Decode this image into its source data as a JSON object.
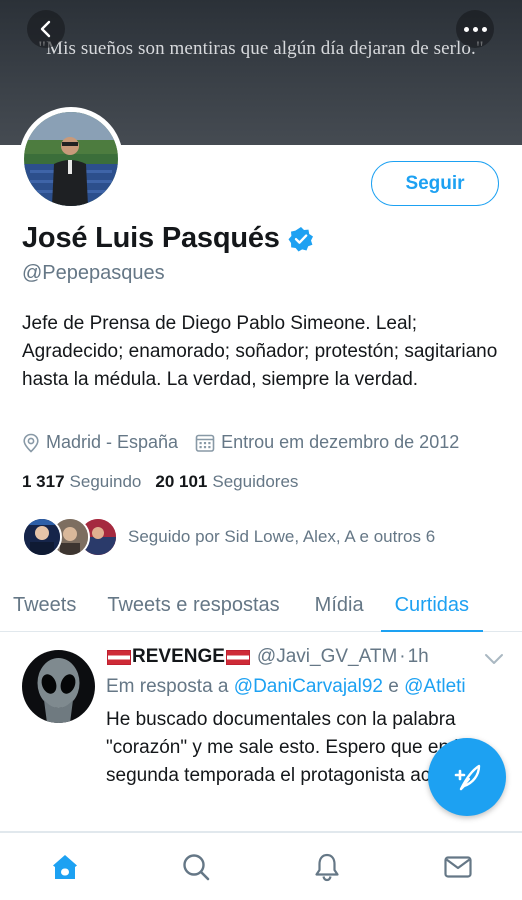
{
  "banner": {
    "quote": "\"Mis sueños son mentiras que algún día dejaran de serlo.\""
  },
  "icons": {
    "back": "chevron-left-icon",
    "more": "more-horizontal-icon",
    "verified": "verified-badge-icon",
    "location": "location-pin-icon",
    "calendar": "calendar-icon",
    "caret": "chevron-down-icon",
    "compose": "compose-feather-icon",
    "home": "home-icon",
    "search": "search-icon",
    "notifications": "bell-icon",
    "messages": "mail-icon"
  },
  "colors": {
    "accent": "#1da1f2",
    "text": "#14171a",
    "secondary": "#657786"
  },
  "profile": {
    "follow_label": "Seguir",
    "name": "José Luis Pasqués",
    "handle": "@Pepepasques",
    "bio": "Jefe de Prensa de Diego Pablo Simeone. Leal; Agradecido; enamorado; soñador; protestón; sagitariano hasta la médula. La verdad, siempre la verdad.",
    "location": "Madrid - España",
    "joined": "Entrou em dezembro de 2012",
    "following_count": "1 317",
    "following_label": "Seguindo",
    "followers_count": "20 101",
    "followers_label": "Seguidores",
    "followed_by": "Seguido por Sid Lowe, Alex, A e outros 6"
  },
  "tabs": [
    {
      "label": "Tweets",
      "active": false
    },
    {
      "label": "Tweets e respostas",
      "active": false
    },
    {
      "label": "Mídia",
      "active": false
    },
    {
      "label": "Curtidas",
      "active": true
    }
  ],
  "tweet": {
    "author": "REVENGE",
    "handle": "@Javi_GV_ATM",
    "separator": "·",
    "time": "1h",
    "reply_prefix": "Em resposta a",
    "reply_mention_1": "@DaniCarvajal92",
    "reply_join": "e",
    "reply_mention_2": "@Atleti",
    "text": "He buscado documentales con la palabra \"corazón\" y me sale esto. Espero que en la segunda temporada el protagonista acabe vivo."
  }
}
